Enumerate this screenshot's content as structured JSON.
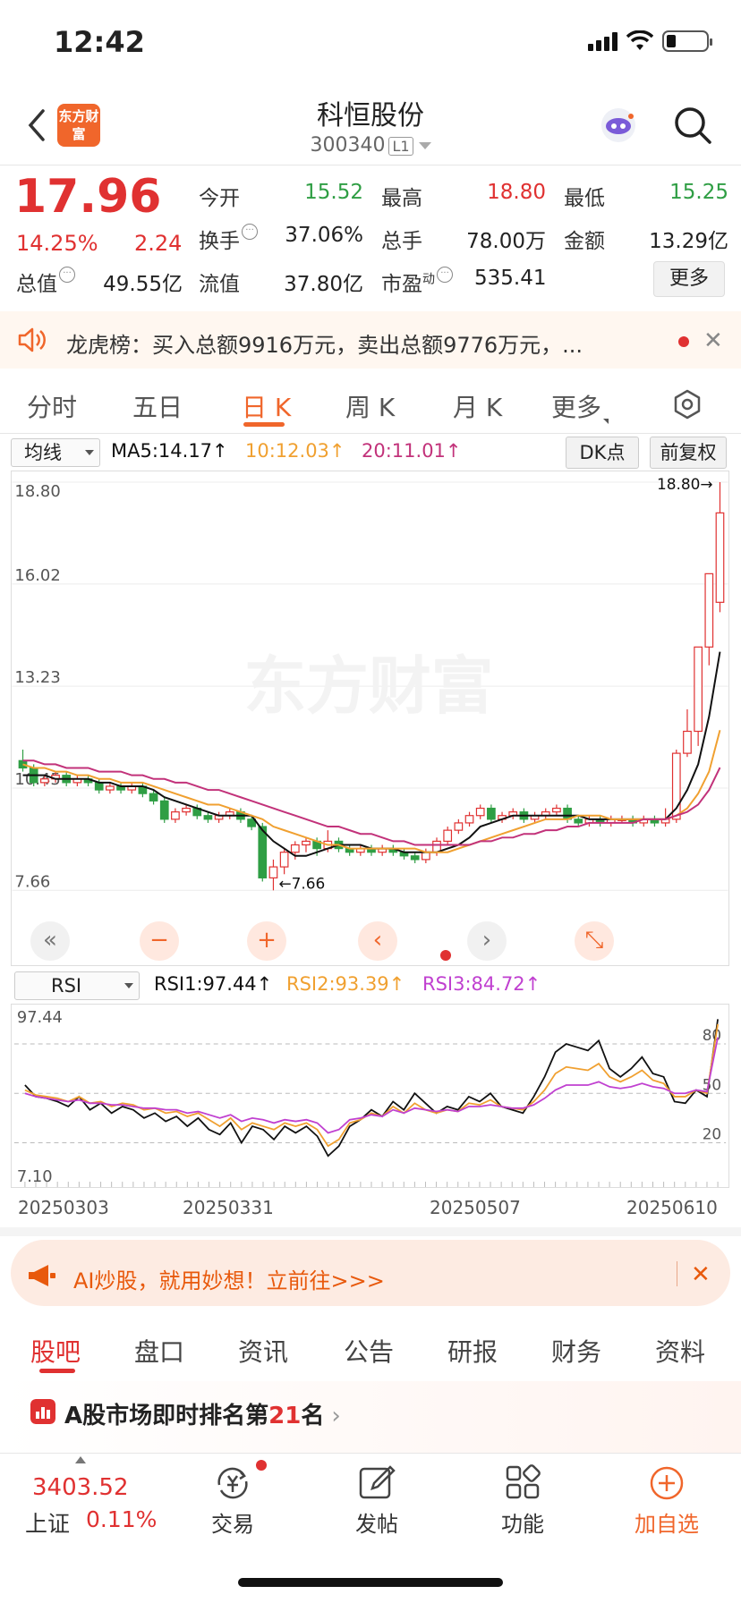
{
  "status": {
    "time": "12:42"
  },
  "header": {
    "logo_text": "东方财富",
    "stock_name": "科恒股份",
    "stock_code": "300340",
    "market_badge": "L1"
  },
  "quote": {
    "price": "17.96",
    "change_pct": "14.25%",
    "change": "2.24",
    "fields": [
      {
        "label": "今开",
        "value": "15.52",
        "color": "#2f9e44"
      },
      {
        "label": "最高",
        "value": "18.80",
        "color": "#e03131"
      },
      {
        "label": "最低",
        "value": "15.25",
        "color": "#2f9e44"
      },
      {
        "label": "换手",
        "value": "37.06%",
        "color": "#333333"
      },
      {
        "label": "总手",
        "value": "78.00万",
        "color": "#333333"
      },
      {
        "label": "金额",
        "value": "13.29亿",
        "color": "#333333"
      },
      {
        "label": "总值",
        "value": "49.55亿",
        "color": "#333333"
      },
      {
        "label": "流值",
        "value": "37.80亿",
        "color": "#333333"
      },
      {
        "label": "市盈",
        "value": "535.41",
        "color": "#333333"
      }
    ],
    "pe_superscript": "动",
    "more_label": "更多"
  },
  "ticker": {
    "text": "龙虎榜：买入总额9916万元，卖出总额9776万元，..."
  },
  "chart_tabs": [
    "分时",
    "五日",
    "日 K",
    "周 K",
    "月 K",
    "更多"
  ],
  "indicators": {
    "ma_select": "均线",
    "ma5": "MA5:14.17↑",
    "ma10": "10:12.03↑",
    "ma20": "20:11.01↑",
    "dk_label": "DK点",
    "fq_label": "前复权",
    "rsi_select": "RSI",
    "rsi1": "RSI1:97.44↑",
    "rsi2": "RSI2:93.39↑",
    "rsi3": "RSI3:84.72↑",
    "colors": {
      "ma5": "#111111",
      "ma10": "#f0a030",
      "ma20": "#c2327a",
      "rsi1": "#111111",
      "rsi2": "#f0a030",
      "rsi3": "#c040d0",
      "up": "#e03131",
      "down": "#2f9e44"
    }
  },
  "watermark": "东方财富",
  "chart_data": [
    {
      "type": "candlestick",
      "y_ticks": [
        "18.80",
        "16.02",
        "13.23",
        "10.45",
        "7.66"
      ],
      "ylim": [
        7.66,
        18.8
      ],
      "high_label": "18.80→",
      "low_label": "←7.66",
      "x_labels": [
        "20250303",
        "20250331",
        "20250507",
        "20250610"
      ],
      "candles": [
        [
          11.2,
          11.0,
          11.5,
          10.9
        ],
        [
          11.0,
          10.6,
          11.1,
          10.5
        ],
        [
          10.6,
          10.7,
          10.8,
          10.5
        ],
        [
          10.7,
          10.8,
          10.9,
          10.6
        ],
        [
          10.8,
          10.6,
          10.9,
          10.5
        ],
        [
          10.6,
          10.7,
          10.8,
          10.5
        ],
        [
          10.7,
          10.6,
          10.8,
          10.5
        ],
        [
          10.6,
          10.4,
          10.7,
          10.3
        ],
        [
          10.4,
          10.5,
          10.6,
          10.3
        ],
        [
          10.5,
          10.4,
          10.6,
          10.3
        ],
        [
          10.4,
          10.5,
          10.6,
          10.3
        ],
        [
          10.5,
          10.3,
          10.6,
          10.2
        ],
        [
          10.3,
          10.1,
          10.4,
          10.0
        ],
        [
          10.1,
          9.6,
          10.2,
          9.5
        ],
        [
          9.6,
          9.8,
          9.9,
          9.5
        ],
        [
          9.8,
          9.9,
          10.0,
          9.7
        ],
        [
          9.9,
          9.7,
          10.0,
          9.6
        ],
        [
          9.7,
          9.6,
          9.8,
          9.5
        ],
        [
          9.6,
          9.7,
          9.8,
          9.5
        ],
        [
          9.7,
          9.8,
          9.9,
          9.6
        ],
        [
          9.8,
          9.6,
          9.9,
          9.5
        ],
        [
          9.6,
          9.4,
          9.7,
          9.3
        ],
        [
          9.4,
          8.0,
          9.5,
          7.9
        ],
        [
          8.0,
          8.3,
          8.5,
          7.66
        ],
        [
          8.3,
          8.7,
          8.8,
          8.1
        ],
        [
          8.7,
          8.9,
          9.0,
          8.5
        ],
        [
          8.9,
          9.0,
          9.1,
          8.7
        ],
        [
          9.0,
          8.8,
          9.1,
          8.6
        ],
        [
          8.8,
          9.0,
          9.3,
          8.7
        ],
        [
          9.0,
          8.8,
          9.1,
          8.7
        ],
        [
          8.8,
          8.7,
          8.9,
          8.6
        ],
        [
          8.7,
          8.8,
          8.9,
          8.6
        ],
        [
          8.8,
          8.7,
          8.9,
          8.6
        ],
        [
          8.7,
          8.8,
          8.9,
          8.6
        ],
        [
          8.8,
          8.7,
          8.9,
          8.6
        ],
        [
          8.7,
          8.6,
          8.8,
          8.5
        ],
        [
          8.6,
          8.5,
          8.7,
          8.4
        ],
        [
          8.5,
          8.7,
          8.8,
          8.4
        ],
        [
          8.7,
          9.0,
          9.1,
          8.6
        ],
        [
          9.0,
          9.3,
          9.4,
          8.9
        ],
        [
          9.3,
          9.5,
          9.6,
          9.2
        ],
        [
          9.5,
          9.7,
          9.8,
          9.4
        ],
        [
          9.7,
          9.9,
          10.0,
          9.6
        ],
        [
          9.9,
          9.6,
          10.0,
          9.5
        ],
        [
          9.6,
          9.7,
          9.8,
          9.5
        ],
        [
          9.7,
          9.8,
          9.9,
          9.6
        ],
        [
          9.8,
          9.6,
          9.9,
          9.5
        ],
        [
          9.6,
          9.7,
          9.8,
          9.5
        ],
        [
          9.7,
          9.8,
          9.9,
          9.6
        ],
        [
          9.8,
          9.9,
          10.0,
          9.7
        ],
        [
          9.9,
          9.6,
          10.0,
          9.5
        ],
        [
          9.6,
          9.5,
          9.7,
          9.4
        ],
        [
          9.5,
          9.6,
          9.7,
          9.4
        ],
        [
          9.6,
          9.5,
          9.7,
          9.4
        ],
        [
          9.5,
          9.6,
          9.7,
          9.4
        ],
        [
          9.6,
          9.6,
          9.7,
          9.5
        ],
        [
          9.6,
          9.5,
          9.7,
          9.4
        ],
        [
          9.5,
          9.6,
          9.7,
          9.4
        ],
        [
          9.6,
          9.5,
          9.7,
          9.4
        ],
        [
          9.5,
          9.6,
          9.9,
          9.4
        ],
        [
          9.6,
          11.4,
          11.5,
          9.5
        ],
        [
          11.4,
          12.0,
          12.6,
          11.3
        ],
        [
          12.0,
          14.3,
          14.3,
          11.6
        ],
        [
          14.3,
          16.3,
          16.3,
          13.8
        ],
        [
          15.52,
          17.96,
          18.8,
          15.25
        ]
      ],
      "ma5": [
        10.8,
        10.8,
        10.8,
        10.7,
        10.7,
        10.7,
        10.7,
        10.6,
        10.6,
        10.5,
        10.5,
        10.5,
        10.4,
        10.2,
        10.1,
        10.0,
        9.9,
        9.8,
        9.7,
        9.7,
        9.7,
        9.7,
        9.3,
        9.0,
        8.8,
        8.6,
        8.6,
        8.7,
        8.8,
        8.9,
        8.9,
        8.9,
        8.8,
        8.8,
        8.8,
        8.7,
        8.7,
        8.7,
        8.7,
        8.8,
        8.9,
        9.1,
        9.4,
        9.5,
        9.6,
        9.7,
        9.7,
        9.7,
        9.7,
        9.7,
        9.7,
        9.7,
        9.6,
        9.6,
        9.6,
        9.6,
        9.6,
        9.6,
        9.6,
        9.6,
        9.9,
        10.4,
        11.1,
        12.4,
        14.17
      ],
      "ma10": [
        11.1,
        11.0,
        11.0,
        10.9,
        10.9,
        10.8,
        10.8,
        10.7,
        10.7,
        10.6,
        10.6,
        10.6,
        10.5,
        10.4,
        10.3,
        10.2,
        10.1,
        10.0,
        10.0,
        9.9,
        9.8,
        9.7,
        9.6,
        9.4,
        9.3,
        9.2,
        9.1,
        9.0,
        8.9,
        8.9,
        8.8,
        8.8,
        8.8,
        8.8,
        8.8,
        8.8,
        8.8,
        8.7,
        8.7,
        8.7,
        8.8,
        8.9,
        9.0,
        9.1,
        9.2,
        9.3,
        9.4,
        9.5,
        9.6,
        9.6,
        9.6,
        9.7,
        9.7,
        9.7,
        9.6,
        9.6,
        9.6,
        9.6,
        9.6,
        9.6,
        9.7,
        9.9,
        10.3,
        10.9,
        12.03
      ],
      "ma20": [
        11.2,
        11.2,
        11.1,
        11.1,
        11.0,
        11.0,
        11.0,
        10.9,
        10.9,
        10.9,
        10.8,
        10.8,
        10.7,
        10.7,
        10.6,
        10.6,
        10.5,
        10.4,
        10.4,
        10.3,
        10.2,
        10.1,
        10.0,
        9.9,
        9.8,
        9.7,
        9.6,
        9.5,
        9.4,
        9.4,
        9.3,
        9.2,
        9.2,
        9.1,
        9.0,
        9.0,
        8.9,
        8.9,
        8.9,
        8.9,
        8.9,
        8.9,
        9.0,
        9.0,
        9.1,
        9.1,
        9.2,
        9.2,
        9.3,
        9.3,
        9.4,
        9.4,
        9.5,
        9.5,
        9.5,
        9.5,
        9.5,
        9.6,
        9.6,
        9.6,
        9.7,
        9.8,
        10.0,
        10.4,
        11.01
      ]
    },
    {
      "type": "line",
      "y_ticks": [
        "97.44",
        "7.10"
      ],
      "ref_lines": [
        80,
        50,
        20
      ],
      "ylim": [
        7.1,
        97.44
      ],
      "series": [
        {
          "name": "RSI1",
          "values": [
            55,
            48,
            47,
            45,
            42,
            48,
            40,
            44,
            38,
            42,
            40,
            35,
            38,
            33,
            36,
            30,
            35,
            28,
            25,
            32,
            20,
            30,
            28,
            22,
            30,
            26,
            30,
            24,
            12,
            18,
            30,
            34,
            40,
            36,
            45,
            40,
            50,
            44,
            38,
            42,
            40,
            48,
            45,
            50,
            42,
            40,
            38,
            48,
            60,
            75,
            80,
            78,
            76,
            82,
            65,
            60,
            65,
            72,
            62,
            60,
            45,
            44,
            52,
            48,
            95
          ]
        },
        {
          "name": "RSI2",
          "values": [
            52,
            49,
            48,
            47,
            45,
            48,
            44,
            45,
            42,
            44,
            43,
            40,
            41,
            38,
            39,
            36,
            38,
            34,
            30,
            35,
            28,
            32,
            30,
            28,
            32,
            30,
            32,
            28,
            18,
            22,
            32,
            34,
            38,
            36,
            42,
            38,
            44,
            40,
            38,
            40,
            39,
            44,
            43,
            46,
            42,
            41,
            40,
            45,
            52,
            62,
            66,
            65,
            64,
            68,
            60,
            57,
            60,
            64,
            58,
            56,
            48,
            48,
            52,
            50,
            92
          ]
        },
        {
          "name": "RSI3",
          "values": [
            50,
            48,
            47,
            46,
            45,
            46,
            44,
            44,
            43,
            43,
            42,
            41,
            41,
            40,
            40,
            38,
            39,
            37,
            35,
            37,
            33,
            35,
            34,
            32,
            34,
            33,
            34,
            32,
            26,
            28,
            34,
            35,
            37,
            36,
            40,
            38,
            41,
            40,
            39,
            40,
            39,
            42,
            42,
            43,
            42,
            41,
            41,
            43,
            47,
            52,
            55,
            55,
            55,
            57,
            54,
            53,
            54,
            56,
            54,
            53,
            50,
            50,
            52,
            51,
            84
          ]
        }
      ]
    }
  ],
  "chart_nav": {
    "first": "«",
    "minus": "−",
    "plus": "+",
    "prev": "‹",
    "next": "›",
    "expand": "⤡"
  },
  "ai_banner": {
    "text": "AI炒股，就用妙想！立前往>>>"
  },
  "bottom_tabs": [
    "股吧",
    "盘口",
    "资讯",
    "公告",
    "研报",
    "财务",
    "资料"
  ],
  "rank": {
    "prefix": "A股市场即时排名第",
    "num": "21",
    "suffix": "名"
  },
  "bottom_nav": {
    "index_value": "3403.52",
    "index_name": "上证",
    "index_pct": "0.11%",
    "items": [
      "交易",
      "发帖",
      "功能",
      "加自选"
    ]
  }
}
